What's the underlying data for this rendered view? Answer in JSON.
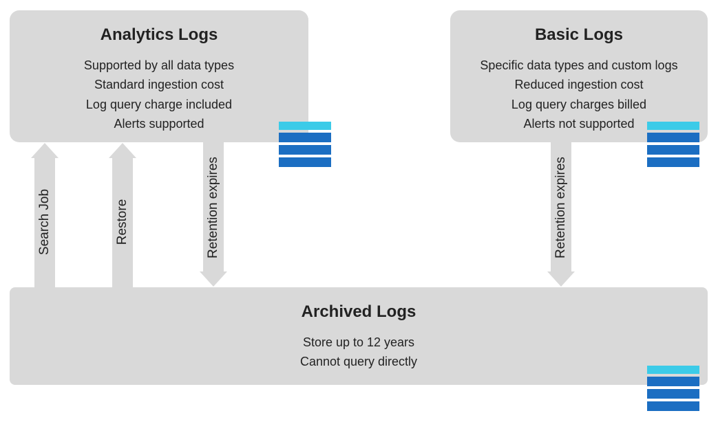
{
  "boxes": {
    "analytics": {
      "title": "Analytics Logs",
      "lines": [
        "Supported by all data types",
        "Standard ingestion cost",
        "Log query charge included",
        "Alerts supported"
      ]
    },
    "basic": {
      "title": "Basic Logs",
      "lines": [
        "Specific data types and custom logs",
        "Reduced ingestion cost",
        "Log query charges billed",
        "Alerts not supported"
      ]
    },
    "archived": {
      "title": "Archived Logs",
      "lines": [
        "Store up to 12 years",
        "Cannot query directly"
      ]
    }
  },
  "arrows": {
    "searchJob": "Search Job",
    "restore": "Restore",
    "retention1": "Retention expires",
    "retention2": "Retention expires"
  },
  "colors": {
    "boxFill": "#d9d9d9",
    "iconHeader": "#3ccbe8",
    "iconRow": "#1b6ec2"
  }
}
